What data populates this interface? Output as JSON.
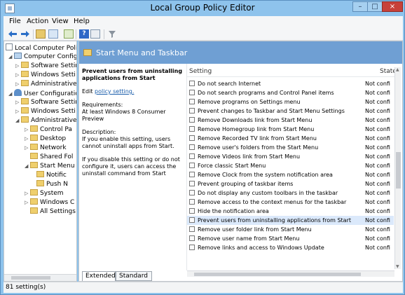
{
  "window": {
    "title": "Local Group Policy Editor"
  },
  "menu": [
    "File",
    "Action",
    "View",
    "Help"
  ],
  "tree": [
    {
      "label": "Local Computer Polic",
      "arrow": "",
      "icon": "policy"
    },
    {
      "label": "Computer Configu",
      "arrow": "◢",
      "icon": "pc"
    },
    {
      "label": "Software Settir",
      "arrow": "▷",
      "icon": "folder"
    },
    {
      "label": "Windows Setti",
      "arrow": "▷",
      "icon": "folder"
    },
    {
      "label": "Administrative",
      "arrow": "▷",
      "icon": "folder"
    },
    {
      "label": "User Configuration",
      "arrow": "◢",
      "icon": "user"
    },
    {
      "label": "Software Settir",
      "arrow": "▷",
      "icon": "folder"
    },
    {
      "label": "Windows Setti",
      "arrow": "▷",
      "icon": "folder"
    },
    {
      "label": "Administrative",
      "arrow": "◢",
      "icon": "folder"
    },
    {
      "label": "Control Pa",
      "arrow": "▷",
      "icon": "folder"
    },
    {
      "label": "Desktop",
      "arrow": "▷",
      "icon": "folder"
    },
    {
      "label": "Network",
      "arrow": "▷",
      "icon": "folder"
    },
    {
      "label": "Shared Fol",
      "arrow": "",
      "icon": "folder"
    },
    {
      "label": "Start Menu",
      "arrow": "◢",
      "icon": "folder"
    },
    {
      "label": "Notific",
      "arrow": "",
      "icon": "folder"
    },
    {
      "label": "Push N",
      "arrow": "",
      "icon": "folder"
    },
    {
      "label": "System",
      "arrow": "▷",
      "icon": "folder"
    },
    {
      "label": "Windows C",
      "arrow": "▷",
      "icon": "folder"
    },
    {
      "label": "All Settings",
      "arrow": "",
      "icon": "folder"
    }
  ],
  "main": {
    "title": "Start Menu and Taskbar",
    "description": {
      "title": "Prevent users from uninstalling applications from Start",
      "edit_prefix": "Edit",
      "edit_link": "policy setting.",
      "requirements_label": "Requirements:",
      "requirements": "At least Windows 8 Consumer Preview",
      "description_label": "Description:",
      "desc_1": "If you enable this setting, users cannot uninstall apps from Start.",
      "desc_2": "If you disable this setting or do not configure it, users can access the uninstall command from Start"
    },
    "columns": {
      "setting": "Setting",
      "state": "State"
    },
    "rows": [
      {
        "name": "Do not search Internet",
        "state": "Not confi"
      },
      {
        "name": "Do not search programs and Control Panel items",
        "state": "Not confi"
      },
      {
        "name": "Remove programs on Settings menu",
        "state": "Not confi"
      },
      {
        "name": "Prevent changes to Taskbar and Start Menu Settings",
        "state": "Not confi"
      },
      {
        "name": "Remove Downloads link from Start Menu",
        "state": "Not confi"
      },
      {
        "name": "Remove Homegroup link from Start Menu",
        "state": "Not confi"
      },
      {
        "name": "Remove Recorded TV link from Start Menu",
        "state": "Not confi"
      },
      {
        "name": "Remove user's folders from the Start Menu",
        "state": "Not confi"
      },
      {
        "name": "Remove Videos link from Start Menu",
        "state": "Not confi"
      },
      {
        "name": "Force classic Start Menu",
        "state": "Not confi"
      },
      {
        "name": "Remove Clock from the system notification area",
        "state": "Not confi"
      },
      {
        "name": "Prevent grouping of taskbar items",
        "state": "Not confi"
      },
      {
        "name": "Do not display any custom toolbars in the taskbar",
        "state": "Not confi"
      },
      {
        "name": "Remove access to the context menus for the taskbar",
        "state": "Not confi"
      },
      {
        "name": "Hide the notification area",
        "state": "Not confi"
      },
      {
        "name": "Prevent users from uninstalling applications from Start",
        "state": "Not confi",
        "selected": true
      },
      {
        "name": "Remove user folder link from Start Menu",
        "state": "Not confi"
      },
      {
        "name": "Remove user name from Start Menu",
        "state": "Not confi"
      },
      {
        "name": "Remove links and access to Windows Update",
        "state": "Not confi"
      }
    ],
    "tabs": [
      "Extended",
      "Standard"
    ]
  },
  "status": "81 setting(s)"
}
